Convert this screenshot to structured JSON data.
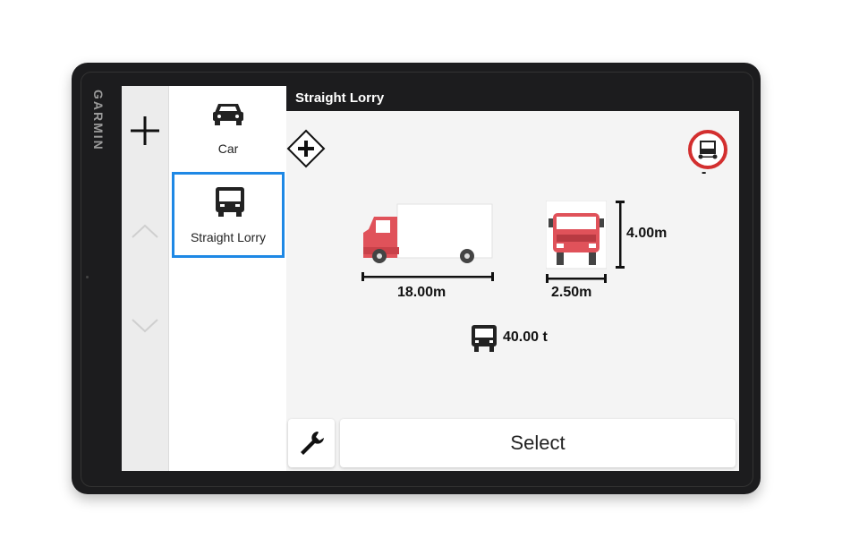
{
  "device": {
    "brand": "GARMIN"
  },
  "header": {
    "title": "Straight Lorry"
  },
  "vehicles": [
    {
      "label": "Car",
      "icon": "car-icon",
      "selected": false
    },
    {
      "label": "Straight Lorry",
      "icon": "lorry-icon",
      "selected": true
    }
  ],
  "profile": {
    "length": "18.00m",
    "width": "2.50m",
    "height": "4.00m",
    "weight": "40.00 t",
    "restriction": "-"
  },
  "actions": {
    "select_label": "Select"
  },
  "colors": {
    "accent": "#1e88e5",
    "truck_red": "#e0525a",
    "bezel": "#1c1c1e",
    "restriction_red": "#d32f2f"
  }
}
